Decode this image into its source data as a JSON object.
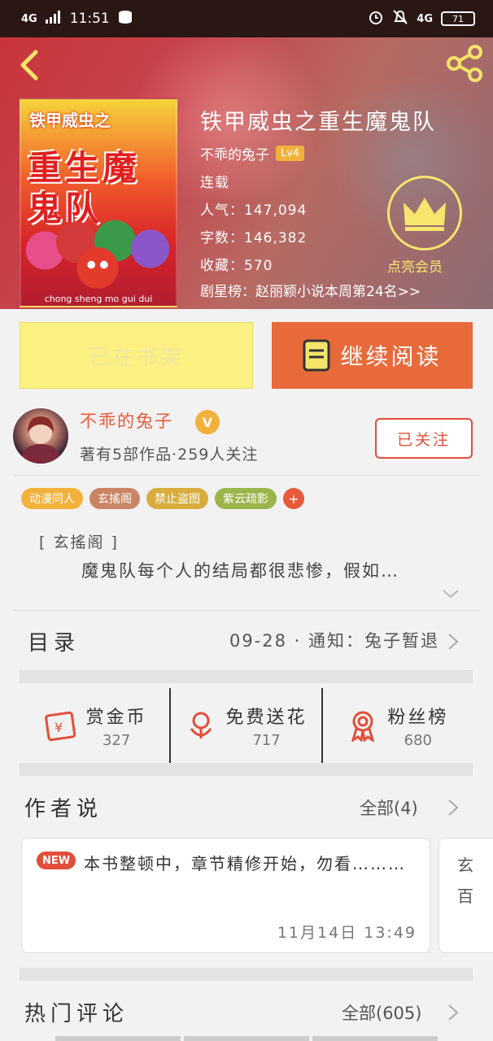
{
  "status_bar": {
    "network_left": "4G",
    "time": "11:51",
    "network_right": "4G",
    "battery": "71"
  },
  "book": {
    "title": "铁甲威虫之重生魔鬼队",
    "author": "不乖的兔子",
    "author_level": "Lv4",
    "state": "连载",
    "popularity": "人气：147,094",
    "words": "字数：146,382",
    "favorites": "收藏：570",
    "ranking": "剧星榜：赵丽颖小说本周第24名>>",
    "vip_label": "点亮会员",
    "cover": {
      "title_top": "铁甲威虫之",
      "title_main": "重生魔鬼队",
      "pinyin": "chong sheng mo gui dui"
    }
  },
  "actions": {
    "shelf": "已在书架",
    "read": "继续阅读"
  },
  "author_card": {
    "name": "不乖的兔子",
    "badge": "V",
    "works": "著有5部作品·259人关注",
    "follow": "已关注"
  },
  "tags": [
    {
      "label": "动漫同人",
      "color": "#f2b13b"
    },
    {
      "label": "玄搖阁",
      "color": "#c98464"
    },
    {
      "label": "禁止盗图",
      "color": "#d8ad3e"
    },
    {
      "label": "紫云疏影",
      "color": "#9bb54a"
    }
  ],
  "tag_more": "+",
  "intro": {
    "category": "[ 玄搖阁 ]",
    "text": "魔鬼队每个人的结局都很悲惨，假如…"
  },
  "toc": {
    "label": "目录",
    "info": "09-28 · 通知：兔子暂退"
  },
  "stats": [
    {
      "name": "赏金币",
      "value": "327",
      "icon": "red-envelope-icon"
    },
    {
      "name": "免费送花",
      "value": "717",
      "icon": "flower-icon"
    },
    {
      "name": "粉丝榜",
      "value": "680",
      "icon": "medal-icon"
    }
  ],
  "author_notes": {
    "title": "作者说",
    "more": "全部(4)",
    "cards": [
      {
        "badge": "NEW",
        "text": "本书整顿中，章节精修开始，勿看………",
        "date": "11月14日    13:49"
      },
      {
        "text": "玄百"
      }
    ]
  },
  "comments": {
    "title": "热门评论",
    "more": "全部(605)"
  },
  "colors": {
    "accent": "#e86a3a",
    "red": "#e24e3a",
    "gold": "#f2b13b",
    "shelf": "#fbf183"
  }
}
